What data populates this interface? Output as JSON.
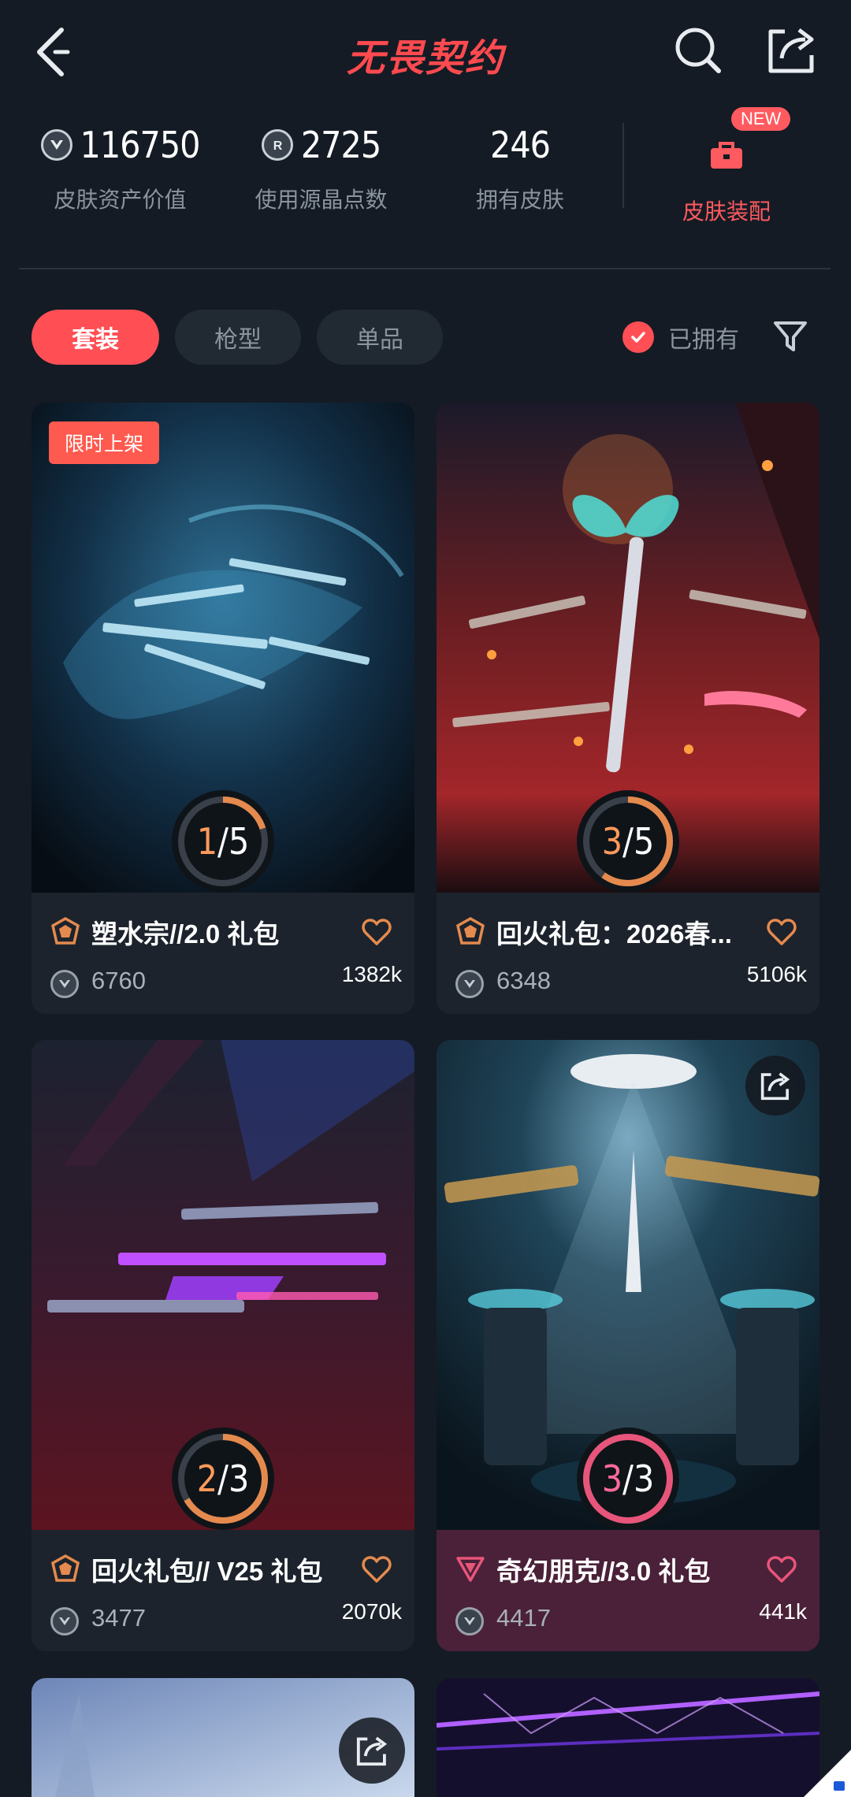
{
  "header": {
    "title": "无畏契约"
  },
  "stats": {
    "asset_value": "116750",
    "asset_value_label": "皮肤资产价值",
    "crystal_points": "2725",
    "crystal_points_label": "使用源晶点数",
    "skins_owned": "246",
    "skins_owned_label": "拥有皮肤",
    "equip_label": "皮肤装配",
    "new_badge": "NEW"
  },
  "filters": {
    "tabs": [
      {
        "label": "套装",
        "active": true
      },
      {
        "label": "枪型",
        "active": false
      },
      {
        "label": "单品",
        "active": false
      }
    ],
    "owned_label": "已拥有"
  },
  "cards": [
    {
      "tag": "限时上架",
      "name": "塑水宗//2.0 礼包",
      "price": "6760",
      "likes": "1382k",
      "owned": "1",
      "total": "5",
      "tier_color": "#e58a4e"
    },
    {
      "name": "回火礼包：2026春...",
      "price": "6348",
      "likes": "5106k",
      "owned": "3",
      "total": "5",
      "tier_color": "#e58a4e"
    },
    {
      "name": "回火礼包// V25 礼包",
      "price": "3477",
      "likes": "2070k",
      "owned": "2",
      "total": "3",
      "tier_color": "#e58a4e"
    },
    {
      "name": "奇幻朋克//3.0 礼包",
      "price": "4417",
      "likes": "441k",
      "owned": "3",
      "total": "3",
      "tier_color": "#e8557a"
    }
  ],
  "colors": {
    "accent": "#ff4f55",
    "background": "#141b24",
    "card": "#1c232c"
  }
}
